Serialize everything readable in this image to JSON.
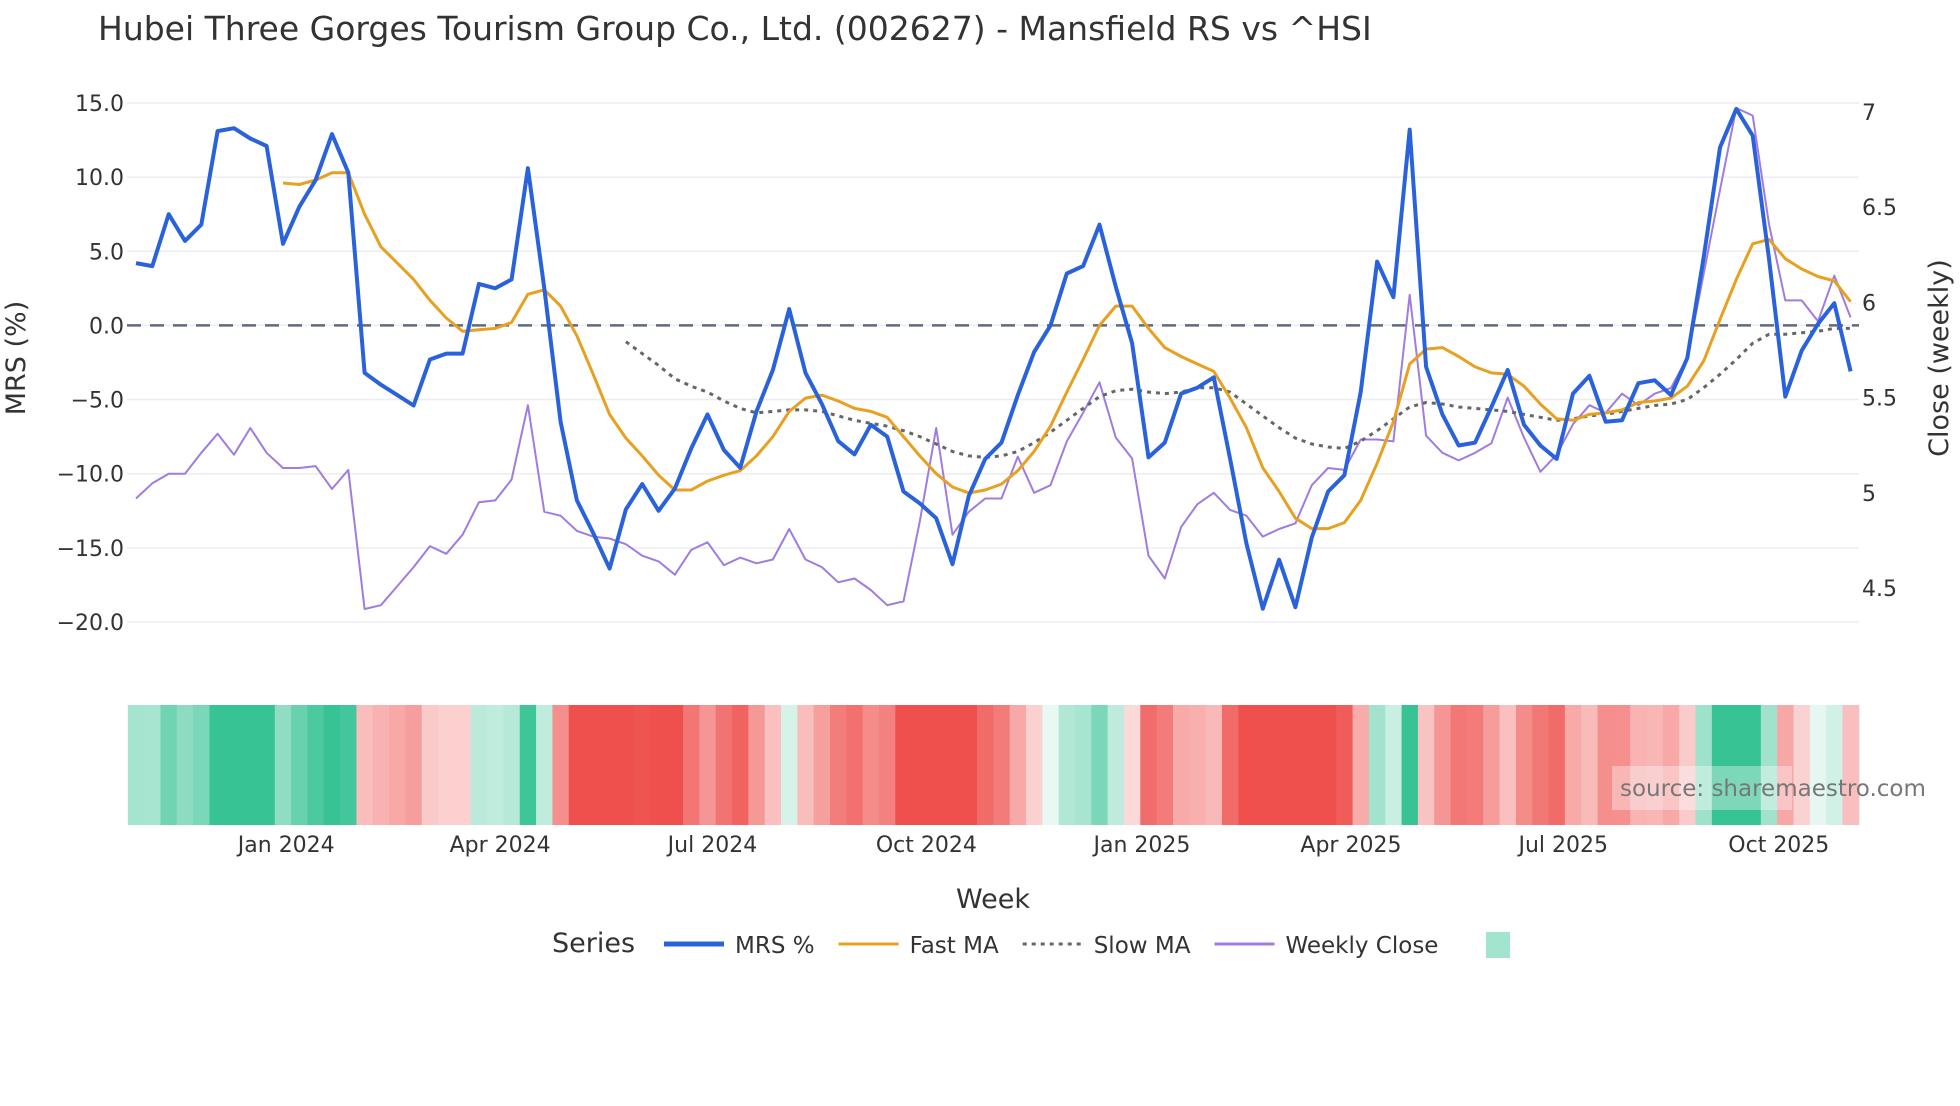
{
  "chart_data": {
    "type": "line",
    "title": "Hubei Three Gorges Tourism Group Co., Ltd. (002627) - Mansfield RS vs ^HSI",
    "xlabel": "Week",
    "ylabel": "MRS (%)",
    "y2label": "Close (weekly)",
    "ylim": [
      -22,
      16.5
    ],
    "y2lim": [
      4.3,
      7.1
    ],
    "yticks": [
      "15.0",
      "10.0",
      "5.0",
      "0.0",
      "−5.0",
      "−10.0",
      "−15.0",
      "−20.0"
    ],
    "ytick_values": [
      15,
      10,
      5,
      0,
      -5,
      -10,
      -15,
      -20
    ],
    "y2ticks": [
      "7",
      "6.5",
      "6",
      "5.5",
      "5",
      "4.5"
    ],
    "y2tick_values": [
      7,
      6.5,
      6,
      5.5,
      5,
      4.5
    ],
    "xticks": [
      "Jan 2024",
      "Apr 2024",
      "Jul 2024",
      "Oct 2024",
      "Jan 2025",
      "Apr 2025",
      "Jul 2025",
      "Oct 2025"
    ],
    "xtick_week_index": [
      9.2,
      22.3,
      35.3,
      48.4,
      61.6,
      74.4,
      87.4,
      100.6
    ],
    "grid": true,
    "zero_line": 0,
    "legend_title": "Series",
    "legend_placement": "bottom-center",
    "series": [
      {
        "name": "MRS %",
        "color": "#2a62dc",
        "axis": "left",
        "start": 0,
        "values": [
          4.2,
          4.0,
          7.5,
          5.7,
          6.8,
          13.1,
          13.3,
          12.6,
          12.1,
          5.5,
          8.0,
          9.8,
          12.9,
          10.3,
          -3.2,
          -4.0,
          -4.7,
          -5.4,
          -2.3,
          -1.9,
          -1.9,
          2.8,
          2.5,
          3.1,
          10.6,
          2.5,
          -6.5,
          -11.8,
          -14.0,
          -16.4,
          -12.4,
          -10.7,
          -12.5,
          -11.0,
          -8.3,
          -6.0,
          -8.4,
          -9.6,
          -5.8,
          -3.0,
          1.1,
          -3.2,
          -5.3,
          -7.8,
          -8.7,
          -6.7,
          -7.5,
          -11.2,
          -12.0,
          -13.0,
          -16.1,
          -11.5,
          -9.0,
          -7.9,
          -4.7,
          -1.8,
          0.0,
          3.5,
          4.0,
          6.8,
          2.6,
          -1.2,
          -8.9,
          -7.9,
          -4.6,
          -4.2,
          -3.5,
          -9.0,
          -14.7,
          -19.1,
          -15.8,
          -19.0,
          -14.3,
          -11.2,
          -10.1,
          -4.5,
          4.3,
          1.9,
          13.2,
          -2.8,
          -6.0,
          -8.1,
          -7.9,
          -5.5,
          -3.0,
          -6.7,
          -8.1,
          -9.0,
          -4.6,
          -3.4,
          -6.5,
          -6.4,
          -3.9,
          -3.7,
          -4.7,
          -2.2,
          4.6,
          12.0,
          14.6,
          12.8,
          4.5,
          -4.8,
          -1.7,
          0.1,
          1.5,
          -3.1
        ]
      },
      {
        "name": "Fast MA",
        "color": "#e8a020",
        "axis": "left",
        "start": 9,
        "values": [
          9.6,
          9.5,
          9.8,
          10.3,
          10.3,
          7.5,
          5.3,
          4.2,
          3.1,
          1.7,
          0.5,
          -0.4,
          -0.3,
          -0.2,
          0.2,
          2.1,
          2.4,
          1.3,
          -0.7,
          -3.3,
          -6.0,
          -7.6,
          -8.8,
          -10.1,
          -11.1,
          -11.1,
          -10.5,
          -10.1,
          -9.8,
          -8.8,
          -7.5,
          -5.8,
          -4.9,
          -4.7,
          -5.1,
          -5.6,
          -5.8,
          -6.2,
          -7.5,
          -8.8,
          -10.0,
          -10.9,
          -11.3,
          -11.1,
          -10.7,
          -9.8,
          -8.5,
          -6.8,
          -4.5,
          -2.3,
          0.0,
          1.3,
          1.3,
          -0.2,
          -1.5,
          -2.1,
          -2.6,
          -3.1,
          -4.9,
          -6.9,
          -9.6,
          -11.2,
          -13.0,
          -13.7,
          -13.7,
          -13.3,
          -11.8,
          -9.3,
          -6.5,
          -2.6,
          -1.6,
          -1.5,
          -2.1,
          -2.8,
          -3.2,
          -3.3,
          -4.1,
          -5.3,
          -6.3,
          -6.4,
          -6.0,
          -5.9,
          -5.7,
          -5.2,
          -5.1,
          -4.9,
          -4.1,
          -2.4,
          0.4,
          3.1,
          5.5,
          5.8,
          4.5,
          3.8,
          3.3,
          3.0,
          1.6
        ]
      },
      {
        "name": "Slow MA",
        "color": "#666666",
        "axis": "left",
        "start": 30,
        "dash": "dot",
        "values": [
          -1.1,
          -1.9,
          -2.7,
          -3.6,
          -4.1,
          -4.5,
          -5.1,
          -5.6,
          -5.9,
          -5.8,
          -5.7,
          -5.7,
          -5.8,
          -6.1,
          -6.4,
          -6.6,
          -6.8,
          -7.1,
          -7.5,
          -8.0,
          -8.5,
          -8.8,
          -8.9,
          -8.8,
          -8.5,
          -7.9,
          -7.2,
          -6.4,
          -5.6,
          -4.8,
          -4.4,
          -4.3,
          -4.5,
          -4.6,
          -4.5,
          -4.2,
          -4.2,
          -4.5,
          -5.3,
          -6.1,
          -6.9,
          -7.6,
          -8.0,
          -8.2,
          -8.3,
          -7.8,
          -7.1,
          -6.3,
          -5.5,
          -5.2,
          -5.3,
          -5.5,
          -5.6,
          -5.7,
          -5.8,
          -6.0,
          -6.2,
          -6.4,
          -6.3,
          -6.1,
          -6.0,
          -5.8,
          -5.6,
          -5.4,
          -5.3,
          -5.0,
          -4.2,
          -3.3,
          -2.3,
          -1.2,
          -0.6,
          -0.6,
          -0.5,
          -0.4,
          -0.2,
          -0.2
        ]
      },
      {
        "name": "Weekly Close",
        "color": "#a07ce0",
        "axis": "right",
        "start": 0,
        "values": [
          4.97,
          5.05,
          5.1,
          5.1,
          5.21,
          5.31,
          5.2,
          5.34,
          5.21,
          5.13,
          5.13,
          5.14,
          5.02,
          5.12,
          4.39,
          4.41,
          4.51,
          4.61,
          4.72,
          4.68,
          4.78,
          4.95,
          4.96,
          5.07,
          5.46,
          4.9,
          4.88,
          4.8,
          4.77,
          4.76,
          4.73,
          4.67,
          4.64,
          4.57,
          4.7,
          4.74,
          4.62,
          4.66,
          4.63,
          4.65,
          4.81,
          4.65,
          4.61,
          4.53,
          4.55,
          4.49,
          4.41,
          4.43,
          4.85,
          5.34,
          4.78,
          4.9,
          4.97,
          4.97,
          5.19,
          5.0,
          5.04,
          5.27,
          5.42,
          5.58,
          5.29,
          5.18,
          4.67,
          4.55,
          4.82,
          4.94,
          5.0,
          4.91,
          4.88,
          4.77,
          4.81,
          4.84,
          5.04,
          5.13,
          5.12,
          5.28,
          5.28,
          5.27,
          6.04,
          5.3,
          5.21,
          5.17,
          5.21,
          5.26,
          5.5,
          5.29,
          5.11,
          5.2,
          5.36,
          5.46,
          5.42,
          5.52,
          5.46,
          5.52,
          5.55,
          5.71,
          6.15,
          6.59,
          7.02,
          6.98,
          6.41,
          6.01,
          6.01,
          5.9,
          6.14,
          5.92
        ]
      }
    ],
    "heatmap": {
      "source_series": "MRS %",
      "positive_color": "#3cc497",
      "negative_color": "#ef5350",
      "legend_swatch": "#a3e4cf"
    },
    "watermark": "source: sharemaestro.com"
  }
}
